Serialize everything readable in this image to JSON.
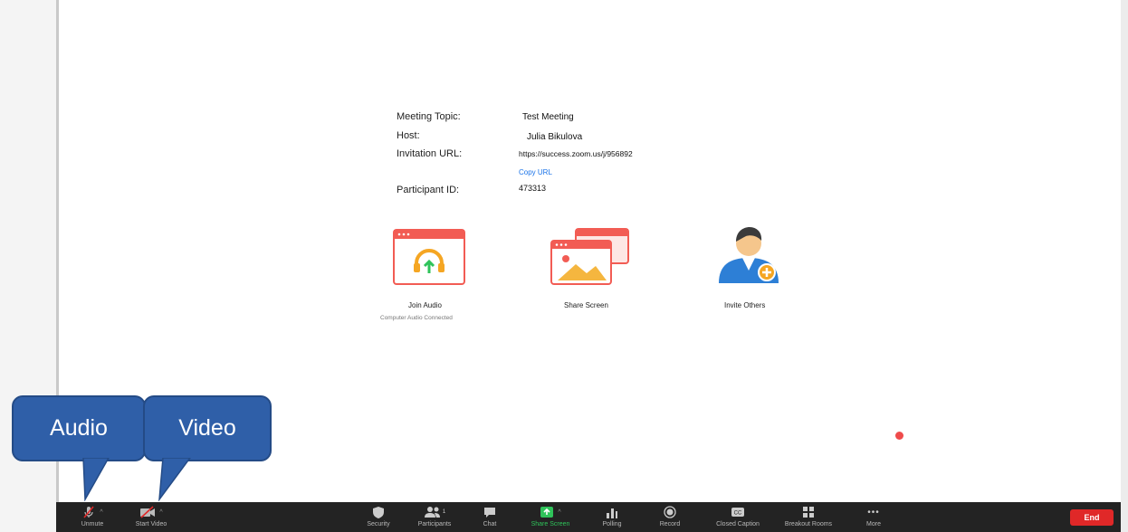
{
  "meeting_info": {
    "topic_label": "Meeting Topic:",
    "topic_value": "Test Meeting",
    "host_label": "Host:",
    "host_value": "Julia Bikulova",
    "url_label": "Invitation URL:",
    "url_value": "https://success.zoom.us/j/956892",
    "copy_url": "Copy URL",
    "participant_label": "Participant ID:",
    "participant_value": "473313"
  },
  "actions": {
    "join_audio": "Join Audio",
    "join_audio_sub": "Computer Audio Connected",
    "share_screen": "Share Screen",
    "invite_others": "Invite Others"
  },
  "callouts": {
    "audio": "Audio",
    "video": "Video"
  },
  "toolbar": {
    "unmute": "Unmute",
    "start_video": "Start Video",
    "security": "Security",
    "participants": "Participants",
    "participants_count": "1",
    "chat": "Chat",
    "share_screen": "Share Screen",
    "polling": "Polling",
    "record": "Record",
    "closed_caption": "Closed Caption",
    "breakout_rooms": "Breakout Rooms",
    "more": "More",
    "end": "End"
  },
  "colors": {
    "toolbar_bg": "#232323",
    "share_green": "#2fc35a",
    "end_red": "#e02828",
    "callout_blue": "#2f5fa8",
    "link_blue": "#1a73e8"
  }
}
